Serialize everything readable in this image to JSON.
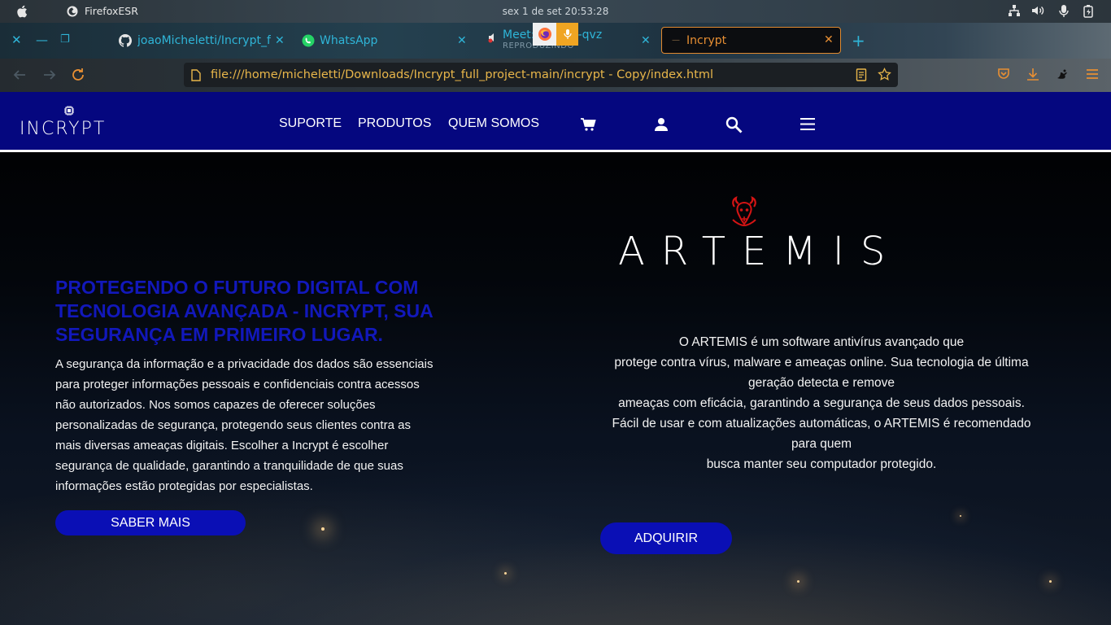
{
  "os": {
    "app_name": "FirefoxESR",
    "clock": "sex 1 de set  20:53:28"
  },
  "browser": {
    "tabs": [
      {
        "title": "joaoMicheletti/Incrypt_full",
        "icon": "github-icon"
      },
      {
        "title": "WhatsApp",
        "icon": "whatsapp-icon"
      },
      {
        "title": "Meet: ",
        "subtitle": "REPRODUZINDO",
        "title_suffix": "k-qvz",
        "icon": "speaker-icon"
      },
      {
        "title": "Incrypt",
        "icon": "page-icon"
      }
    ],
    "url": "file:///home/micheletti/Downloads/Incrypt_full_project-main/incrypt - Copy/index.html"
  },
  "site": {
    "logo_text": "INCRYPT",
    "menu": [
      "SUPORTE",
      "PRODUTOS",
      "QUEM SOMOS"
    ],
    "hero_title": "PROTEGENDO O FUTURO DIGITAL COM TECNOLOGIA AVANÇADA - INCRYPT, SUA SEGURANÇA EM PRIMEIRO LUGAR.",
    "hero_text": "A segurança da informação e a privacidade dos dados são essenciais para proteger informações pessoais e confidenciais contra acessos não autorizados. Nos somos capazes de oferecer soluções personalizadas de segurança, protegendo seus clientes contra as mais diversas ameaças digitais. Escolher a Incrypt é escolher segurança de qualidade, garantindo a tranquilidade de que suas informações estão protegidas por especialistas.",
    "saber_mais": "SABER MAIS",
    "product_name": "ARTEMIS",
    "product_desc": [
      "O ARTEMIS é um software antivírus avançado que",
      "protege contra vírus, malware e ameaças online. Sua tecnologia de última geração detecta e remove",
      "ameaças com eficácia, garantindo a segurança de seus dados pessoais.",
      "Fácil de usar e com atualizações automáticas, o ARTEMIS é recomendado para quem",
      "busca manter seu computador protegido."
    ],
    "adquirir": "ADQUIRIR"
  },
  "colors": {
    "header": "#05077f",
    "hero_title": "#1218bb",
    "button": "#0a0fb5",
    "tab_accent": "#e88f33",
    "url_text": "#e8b64a",
    "emblem": "#d41414"
  }
}
